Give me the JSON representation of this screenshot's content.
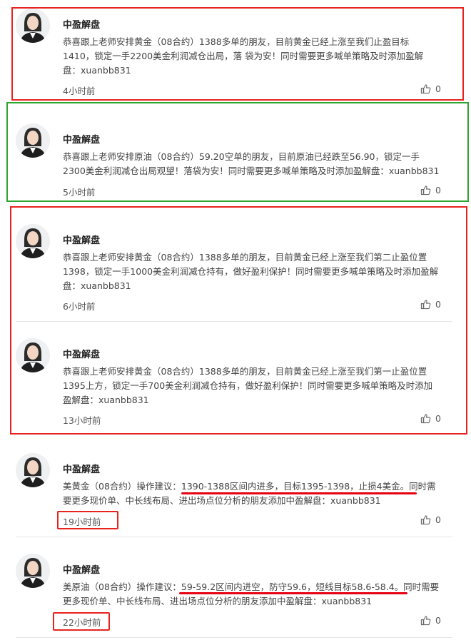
{
  "posts": [
    {
      "author": "中盈解盘",
      "text_lines": [
        "恭喜跟上老师安排黄金（08合约）1388多单的朋友，目前黄金已经上涨至我们止盈目标",
        "1410，锁定一手2200美金利润减仓出局，落 袋为安！同时需要更多喊单策略及时添加盈解",
        "盘：xuanbb831"
      ],
      "time": "4小时前",
      "likes": "0"
    },
    {
      "author": "中盈解盘",
      "text_lines": [
        "恭喜跟上老师安排原油（08合约）59.20空单的朋友，目前原油已经跌至56.90，锁定一手",
        "2300美金利润减仓出局观望！落袋为安！同时需要更多喊单策略及时添加盈解盘：xuanbb831"
      ],
      "time": "5小时前",
      "likes": "0"
    },
    {
      "author": "中盈解盘",
      "text_lines": [
        "恭喜跟上老师安排黄金（08合约）1388多单的朋友，目前黄金已经上涨至我们第二止盈位置",
        "1398，锁定一手1000美金利润减仓持有，做好盈利保护！同时需要更多喊单策略及时添加盈解",
        "盘：xuanbb831"
      ],
      "time": "6小时前",
      "likes": "0"
    },
    {
      "author": "中盈解盘",
      "text_lines": [
        "恭喜跟上老师安排黄金（08合约）1388多单的朋友，目前黄金已经上涨至我们第一止盈位置",
        "1395上方，锁定一手700美金利润减仓持有，做好盈利保护！同时需要更多喊单策略及时添加",
        "盈解盘：xuanbb831"
      ],
      "time": "13小时前",
      "likes": "0"
    },
    {
      "author": "中盈解盘",
      "text_lines": [
        "美黄金（08合约）操作建议：1390-1388区间内进多，目标1395-1398，止损4美金。同时需",
        "要更多现价单、中长线布局、进出场点位分析的朋友添加中盈解盘：xuanbb831"
      ],
      "time": "19小时前",
      "likes": "0"
    },
    {
      "author": "中盈解盘",
      "text_lines": [
        "美原油（08合约）操作建议：59-59.2区间内进空，防守59.6，短线目标58.6-58.4。同时需要",
        "更多现价单、中长线布局、进出场点位分析的朋友添加中盈解盘：xuanbb831"
      ],
      "time": "22小时前",
      "likes": "0"
    }
  ],
  "colors": {
    "box_red": "#e8231f",
    "box_green": "#2ea52e",
    "underline": "#e60012"
  },
  "icons": {
    "like": "thumbs-up-icon",
    "avatar": "avatar-woman-icon"
  }
}
